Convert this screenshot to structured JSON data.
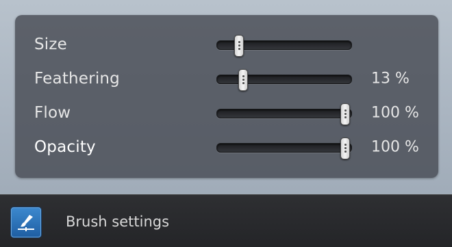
{
  "brush_panel": {
    "sliders": [
      {
        "label": "Size",
        "value_text": "",
        "fraction": 0.16
      },
      {
        "label": "Feathering",
        "value_text": "13 %",
        "fraction": 0.19
      },
      {
        "label": "Flow",
        "value_text": "100 %",
        "fraction": 0.95
      },
      {
        "label": "Opacity",
        "value_text": "100 %",
        "fraction": 0.95
      }
    ]
  },
  "footer": {
    "button_icon": "brush-icon",
    "title": "Brush settings"
  },
  "colors": {
    "accent": "#2a6fb8",
    "panel_bg": "#484c54",
    "footer_bg": "#2a2b2e",
    "text": "#e6e6e6"
  }
}
